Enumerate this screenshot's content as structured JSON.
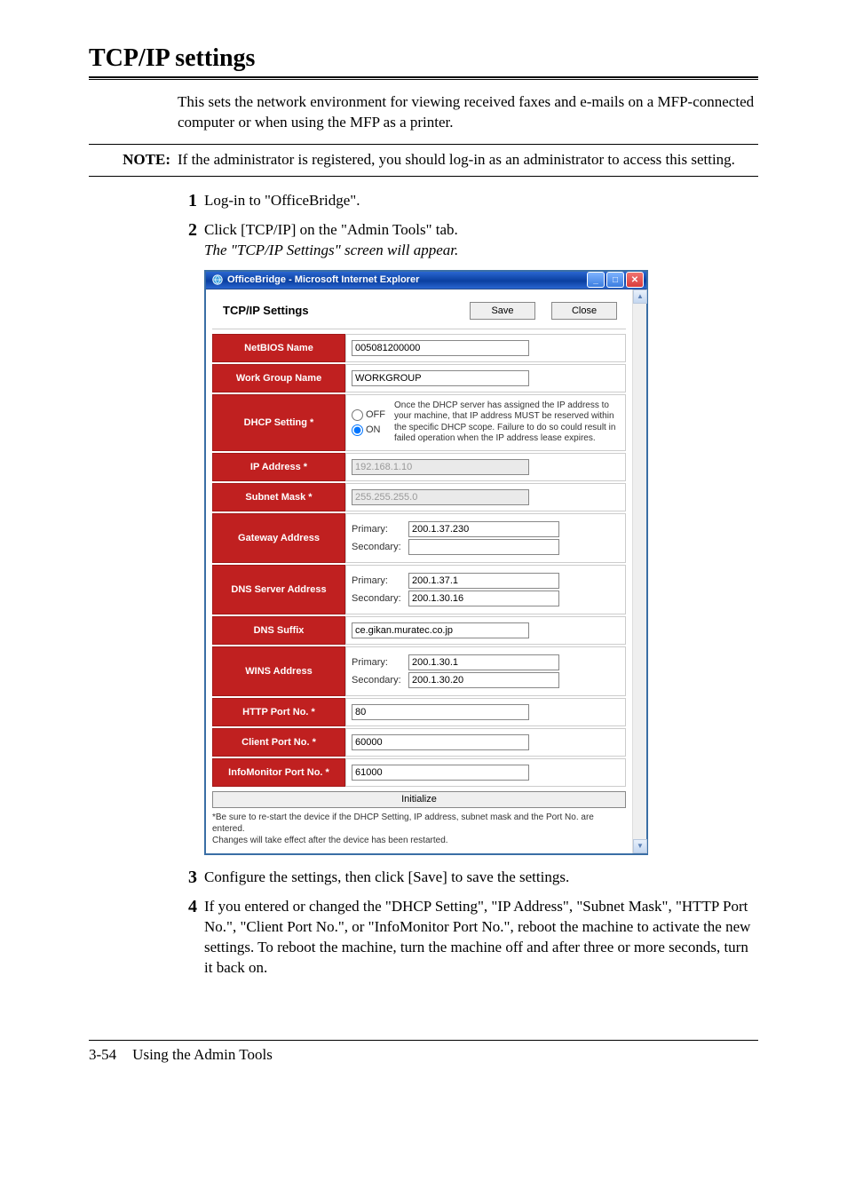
{
  "page": {
    "heading": "TCP/IP settings",
    "intro": "This sets the network environment for viewing received faxes and e-mails on a MFP-connected computer or when using the MFP as a printer.",
    "note_label": "NOTE:",
    "note_text": "If the administrator is registered, you should log-in as an administrator to access this setting.",
    "footer_page": "3-54",
    "footer_title": "Using the Admin Tools"
  },
  "steps": {
    "n1": "1",
    "s1": "Log-in to \"OfficeBridge\".",
    "n2": "2",
    "s2a": "Click [TCP/IP] on the \"Admin Tools\" tab.",
    "s2b": "The \"TCP/IP Settings\" screen will appear.",
    "n3": "3",
    "s3": "Configure the settings, then click [Save] to save the settings.",
    "n4": "4",
    "s4": "If you entered or changed the \"DHCP Setting\", \"IP Address\", \"Subnet Mask\", \"HTTP Port No.\", \"Client Port No.\", or \"InfoMonitor Port No.\", reboot the machine to activate the new settings. To reboot the machine, turn the machine off and after three or more seconds, turn it back on."
  },
  "win": {
    "title": "OfficeBridge - Microsoft Internet Explorer",
    "header_title": "TCP/IP Settings",
    "save": "Save",
    "close": "Close",
    "initialize": "Initialize",
    "labels": {
      "netbios": "NetBIOS Name",
      "workgroup": "Work Group Name",
      "dhcp": "DHCP Setting *",
      "ip": "IP Address *",
      "subnet": "Subnet Mask *",
      "gateway": "Gateway Address",
      "dns": "DNS Server Address",
      "suffix": "DNS Suffix",
      "wins": "WINS Address",
      "http": "HTTP Port No. *",
      "client": "Client Port No. *",
      "infomon": "InfoMonitor Port No. *"
    },
    "values": {
      "netbios": "005081200000",
      "workgroup": "WORKGROUP",
      "dhcp_off": "OFF",
      "dhcp_on": "ON",
      "dhcp_note": "Once the DHCP server has assigned the IP address to your machine, that IP address MUST be reserved within the specific DHCP scope. Failure to do so could result in failed operation when the IP address lease expires.",
      "ip": "192.168.1.10",
      "subnet": "255.255.255.0",
      "primary": "Primary:",
      "secondary": "Secondary:",
      "gateway_p": "200.1.37.230",
      "gateway_s": "",
      "dns_p": "200.1.37.1",
      "dns_s": "200.1.30.16",
      "suffix": "ce.gikan.muratec.co.jp",
      "wins_p": "200.1.30.1",
      "wins_s": "200.1.30.20",
      "http": "80",
      "client": "60000",
      "infomon": "61000"
    },
    "footnote1": "*Be sure to re-start the device if the DHCP Setting, IP address, subnet mask and the Port No. are entered.",
    "footnote2": "Changes will take effect after the device has been restarted."
  }
}
